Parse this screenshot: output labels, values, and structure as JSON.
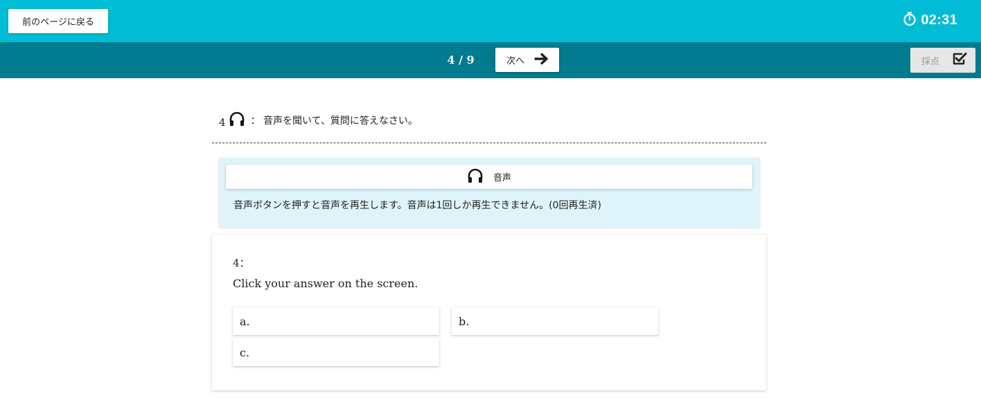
{
  "header": {
    "back_label": "前のページに戻る",
    "timer": "02:31",
    "timer_icon": "stopwatch-icon"
  },
  "nav": {
    "page_indicator": "4 / 9",
    "current_page": 4,
    "total_pages": 9,
    "next_label": "次へ",
    "next_icon": "arrow-right-icon",
    "grade_label": "採点",
    "grade_icon": "checkbox-checked-icon"
  },
  "question": {
    "number": "4",
    "instruction": "：  音声を聞いて、質問に答えなさい。",
    "header_icon": "headphones-icon"
  },
  "audio": {
    "button_label": "音声",
    "button_icon": "headphones-icon",
    "note": "音声ボタンを押すと音声を再生します。音声は1回しか再生できません。(0回再生済)"
  },
  "card": {
    "number": "4：",
    "prompt": "Click your answer on the screen.",
    "choices": [
      {
        "label": "a."
      },
      {
        "label": "b."
      },
      {
        "label": "c."
      }
    ]
  },
  "colors": {
    "topbar": "#00bcd4",
    "navbar": "#007b8f",
    "audio_panel": "#dff3fb",
    "grade_disabled": "#e6e6e6"
  }
}
